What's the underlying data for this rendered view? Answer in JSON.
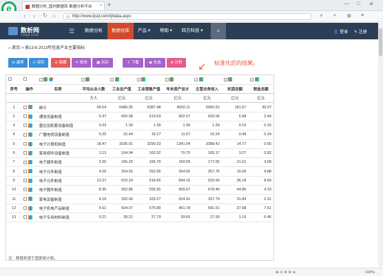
{
  "browser": {
    "tab_title": "数据分析_国内数据库-数据分析平台",
    "url": "http://www.tjsql.com/tj/data.aspx",
    "zoom": "100%"
  },
  "site": {
    "name": "数析网",
    "sub": "TJSQL.COM",
    "nav": [
      "数据分析",
      "数据仓库",
      "产品",
      "帮助",
      "四方科技"
    ],
    "login": "登录",
    "register": "注册"
  },
  "breadcrumb": "首页 > 表13-8 2013年信息产业主要指标",
  "toolbar": [
    "减项",
    "保存",
    "隐藏",
    "修改",
    "另存",
    "下载",
    "全选",
    "分析"
  ],
  "annotation": "标准化后的结果。",
  "table": {
    "headers": [
      "序号",
      "操作",
      "名称",
      "平均从业人数",
      "工业总产值",
      "工业销售产值",
      "年末资产总计",
      "主营业务收入",
      "利润总额",
      "税金总额"
    ],
    "units": [
      "",
      "",
      "",
      "万人",
      "亿元",
      "亿元",
      "亿元",
      "亿元",
      "亿元",
      "亿元"
    ],
    "rows": [
      [
        "1",
        "统计",
        "58.04",
        "6486.35",
        "6387.48",
        "4502.11",
        "6560.52",
        "181.67",
        "35.07"
      ],
      [
        "2",
        "通信设备制造",
        "5.37",
        "650.08",
        "619.53",
        "562.07",
        "620.06",
        "5.98",
        "2.44"
      ],
      [
        "3",
        "雷达及配套设备制造",
        "0.03",
        "1.39",
        "1.39",
        "1.39",
        "1.39",
        "0.15",
        "0.16"
      ],
      [
        "4",
        "广播电视设备制造",
        "0.25",
        "15.44",
        "15.27",
        "11.67",
        "15.24",
        "0.49",
        "0.24"
      ],
      [
        "5",
        "电子计算机制造",
        "18.47",
        "3335.91",
        "3290.23",
        "1341.04",
        "3388.42",
        "14.77",
        "0.65"
      ],
      [
        "6",
        "家用视听设备制造",
        "1.13",
        "164.04",
        "162.92",
        "79.70",
        "165.17",
        "3.27",
        "0.82"
      ],
      [
        "7",
        "电子器件制造",
        "2.00",
        "165.29",
        "166.79",
        "160.09",
        "177.65",
        "21.61",
        "4.58"
      ],
      [
        "8",
        "电子元件制造",
        "4.06",
        "254.55",
        "252.65",
        "254.55",
        "257.76",
        "16.09",
        "4.88"
      ],
      [
        "9",
        "电子元件制造",
        "12.37",
        "523.20",
        "518.65",
        "694.15",
        "520.56",
        "36.18",
        "8.69"
      ],
      [
        "10",
        "电子器件制造",
        "8.35",
        "562.86",
        "556.81",
        "955.67",
        "678.46",
        "44.85",
        "4.33"
      ],
      [
        "11",
        "家电设备制造",
        "4.16",
        "332.00",
        "333.27",
        "624.41",
        "337.79",
        "31.84",
        "2.31"
      ],
      [
        "12",
        "电子机电产品制造",
        "5.61",
        "504.07",
        "575.89",
        "451.78",
        "581.51",
        "37.98",
        "7.61"
      ],
      [
        "13",
        "电子专用材料制造",
        "0.21",
        "28.21",
        "27.79",
        "39.69",
        "27.90",
        "1.19",
        "0.46"
      ]
    ]
  },
  "note": "注：数据来源于国家统计局。"
}
